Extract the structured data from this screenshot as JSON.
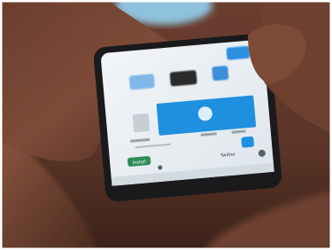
{
  "screen": {
    "install_button_label": "Install",
    "app_name_label": "Twitter"
  },
  "colors": {
    "background_skin": "#5a3428",
    "skin_shadow": "#2e1a14",
    "skin_mid": "#7a4a38",
    "skin_highlight": "#b07a5e",
    "shirt_blue": "#8fc2dc",
    "phone_frame": "#1a1a1c",
    "screen_bg": "#e9eef2",
    "accent_blue": "#1f8fe0",
    "install_green": "#2e8b57",
    "frame": "#ffffff"
  }
}
